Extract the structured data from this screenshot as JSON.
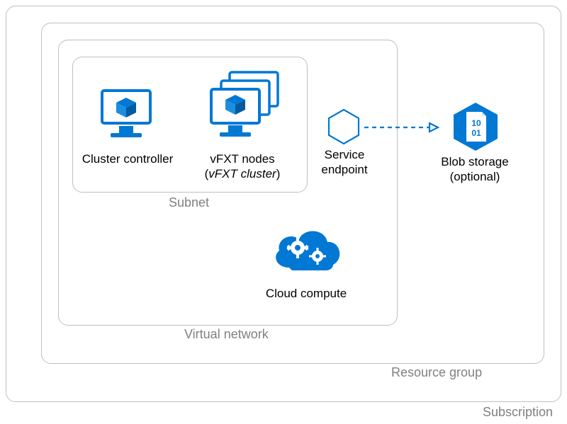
{
  "diagram": {
    "boxes": {
      "subscription": "Subscription",
      "resource_group": "Resource group",
      "virtual_network": "Virtual network",
      "subnet": "Subnet"
    },
    "nodes": {
      "cluster_controller": "Cluster controller",
      "vfxt_nodes_l1": "vFXT nodes",
      "vfxt_nodes_l2_open": "(",
      "vfxt_nodes_l2_italic": "vFXT cluster",
      "vfxt_nodes_l2_close": ")",
      "service_endpoint_l1": "Service",
      "service_endpoint_l2": "endpoint",
      "blob_l1": "Blob storage",
      "blob_l2": "(optional)",
      "cloud_compute": "Cloud compute"
    },
    "colors": {
      "azure": "#0078d4",
      "border": "#bfbfbf",
      "muted": "#808080"
    }
  }
}
